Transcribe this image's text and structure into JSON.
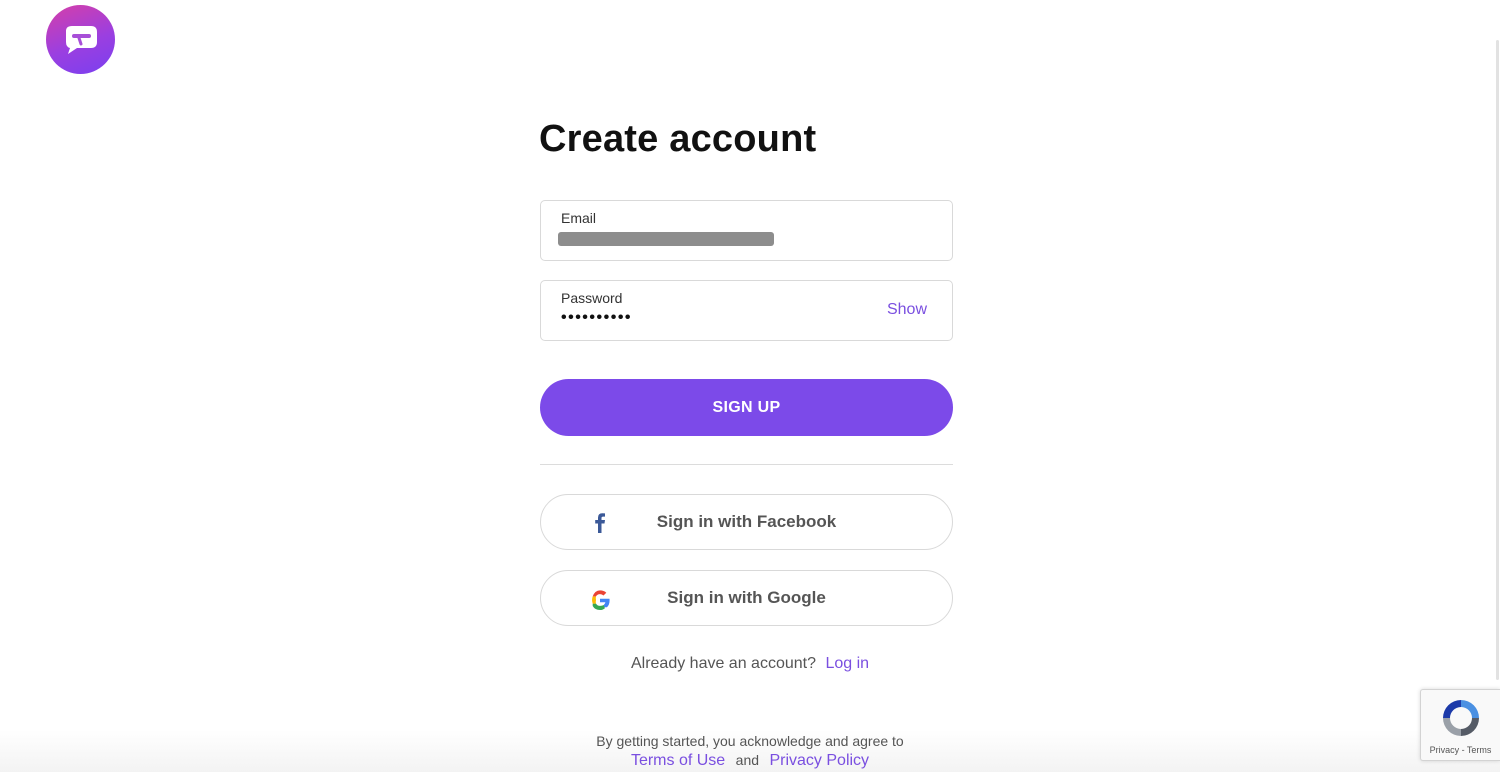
{
  "app": {
    "logo_icon": "chat-bubble-logo-icon"
  },
  "page": {
    "title": "Create account"
  },
  "form": {
    "email": {
      "label": "Email",
      "value_redacted": true
    },
    "password": {
      "label": "Password",
      "value": "••••••••••",
      "show_label": "Show"
    },
    "signup_label": "SIGN UP"
  },
  "oauth": {
    "facebook_label": "Sign in with Facebook",
    "facebook_icon": "facebook-icon",
    "google_label": "Sign in with Google",
    "google_icon": "google-icon"
  },
  "login": {
    "prompt": "Already have an account?",
    "link": "Log in"
  },
  "legal": {
    "text": "By getting started, you acknowledge and agree to",
    "terms": "Terms of Use",
    "and": "and",
    "privacy": "Privacy Policy"
  },
  "recaptcha": {
    "text": "Privacy - Terms"
  },
  "colors": {
    "accent": "#7c4ae9",
    "link": "#7a4fe0",
    "border": "#d9d9d9"
  }
}
